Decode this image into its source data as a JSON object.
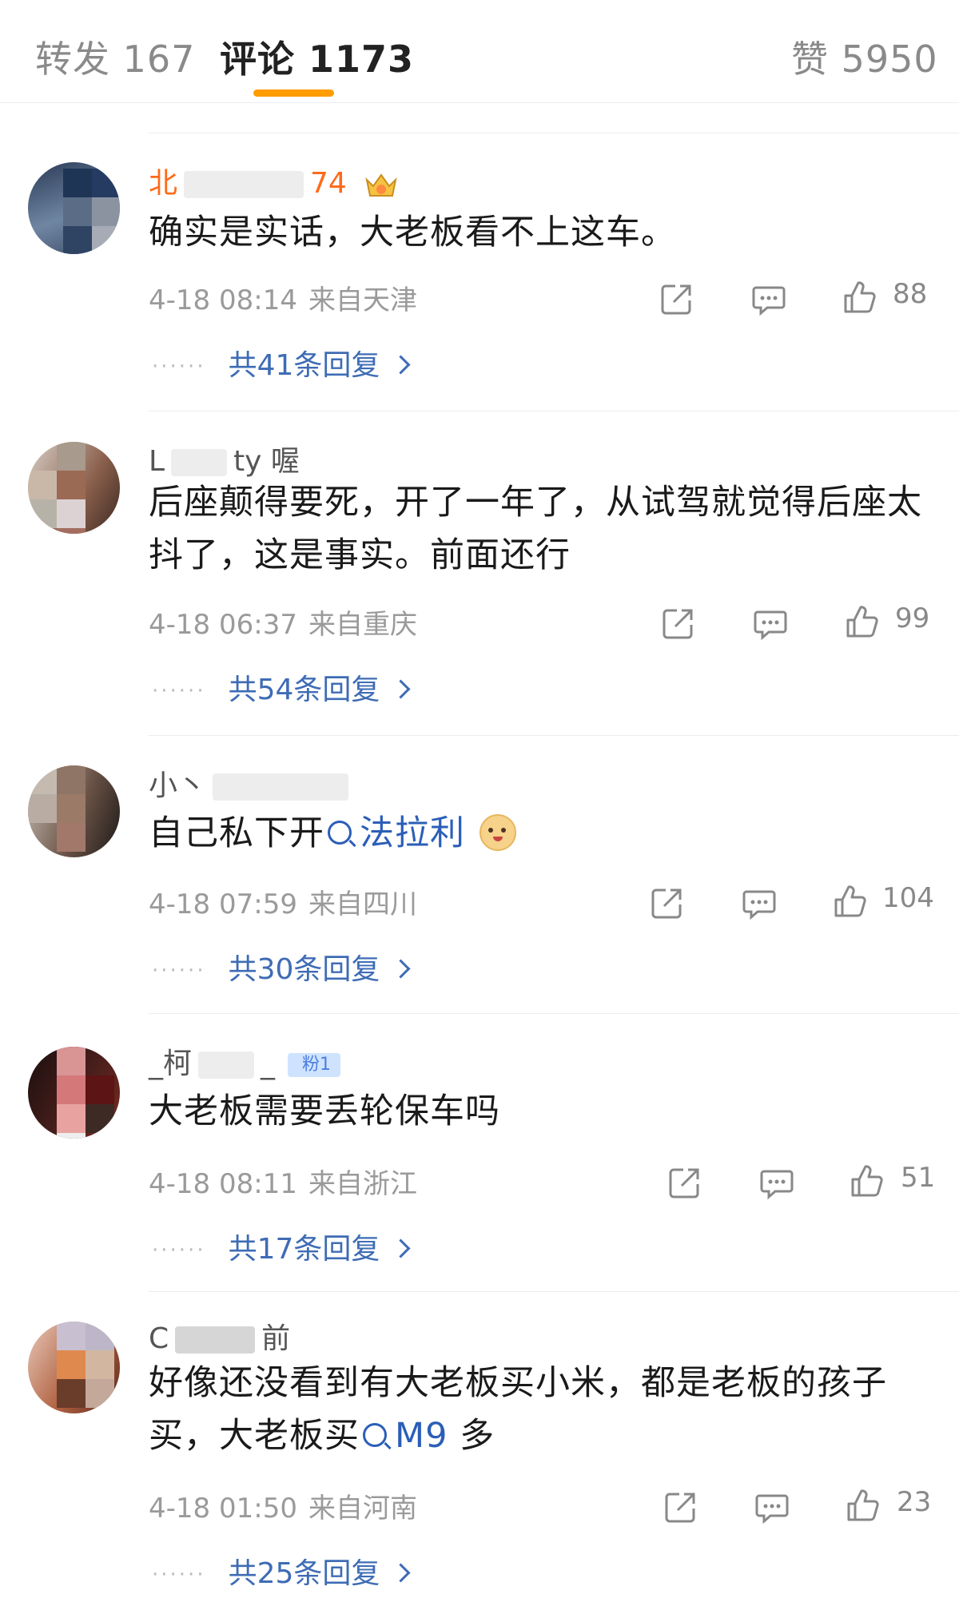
{
  "tabs": {
    "reposts": "转发 167",
    "comments": "评论 1173",
    "likes": "赞 5950"
  },
  "comments": [
    {
      "username_prefix": "北",
      "username_suffix": "74",
      "text": "确实是实话，大老板看不上这车。",
      "time": "4-18 08:14",
      "location": "来自天津",
      "likes": "88",
      "replies": "共41条回复"
    },
    {
      "username_prefix": "L",
      "username_suffix": "ty 喔",
      "text": "后座颠得要死，开了一年了，从试驾就觉得后座太抖了，这是事实。前面还行",
      "time": "4-18 06:37",
      "location": "来自重庆",
      "likes": "99",
      "replies": "共54条回复"
    },
    {
      "username_prefix": "小丶",
      "username_suffix": "",
      "text_before": "自己私下开",
      "link_text": "法拉利",
      "time": "4-18 07:59",
      "location": "来自四川",
      "likes": "104",
      "replies": "共30条回复"
    },
    {
      "username_prefix": "_柯",
      "username_suffix": "_",
      "badge": "粉1",
      "text": "大老板需要丢轮保车吗",
      "time": "4-18 08:11",
      "location": "来自浙江",
      "likes": "51",
      "replies": "共17条回复"
    },
    {
      "username_prefix": "C",
      "username_suffix": "前",
      "text_before": "好像还没看到有大老板买小米，都是老板的孩子买，大老板买",
      "link_text": "M9",
      "text_after": "多",
      "time": "4-18 01:50",
      "location": "来自河南",
      "likes": "23",
      "replies": "共25条回复"
    }
  ],
  "colors": {
    "accent": "#ff9c00",
    "link": "#2b5eb8",
    "vip_name": "#ff6a1a"
  }
}
